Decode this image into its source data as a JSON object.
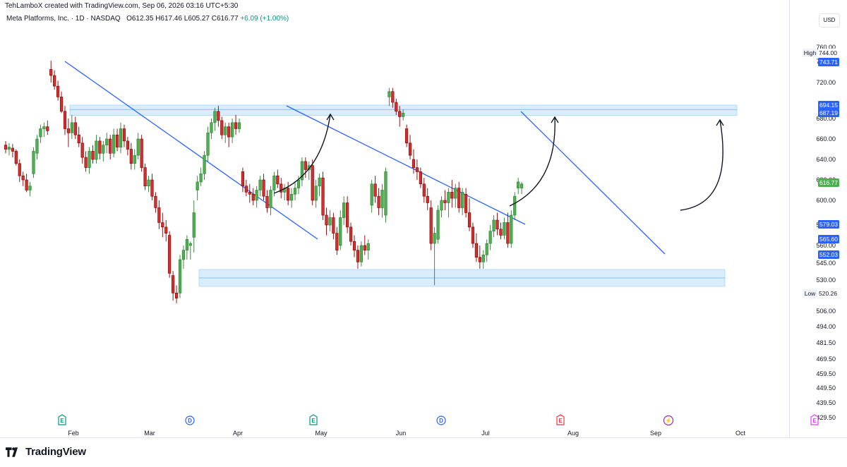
{
  "header": {
    "credit": "TehLamboX created with TradingView.com, Sep 06, 2026 03:16 UTC+5:30",
    "symbol_title": "Meta Platforms, Inc. · 1D · NASDAQ",
    "ohlc": "O612.35  H617.46  L605.27  C616.77",
    "change": "+6.09 (+1.00%)",
    "currency": "USD"
  },
  "footer": {
    "brand": "TradingView"
  },
  "chart_data": {
    "type": "candlestick",
    "symbol": "Meta Platforms, Inc.",
    "interval": "1D",
    "exchange": "NASDAQ",
    "y_axis": {
      "ticks": [
        760.0,
        744.0,
        720.0,
        680.0,
        660.0,
        640.0,
        620.0,
        600.0,
        580.0,
        560.0,
        545.0,
        530.0,
        506.0,
        494.0,
        481.5,
        469.5,
        459.5,
        449.5,
        439.5,
        429.5
      ],
      "range": [
        425,
        770
      ]
    },
    "x_axis": {
      "ticks": [
        "Feb",
        "Mar",
        "Apr",
        "May",
        "Jun",
        "Jul",
        "Aug",
        "Sep",
        "Oct"
      ]
    },
    "price_labels": [
      {
        "value": "744.00",
        "kind": "plain"
      },
      {
        "value": "743.71",
        "kind": "tag"
      },
      {
        "value": "694.15",
        "kind": "tag"
      },
      {
        "value": "687.19",
        "kind": "tag"
      },
      {
        "value": "616.77",
        "kind": "last"
      },
      {
        "value": "579.03",
        "kind": "tag"
      },
      {
        "value": "565.60",
        "kind": "tag"
      },
      {
        "value": "552.03",
        "kind": "tag"
      },
      {
        "value": "520.26",
        "kind": "plain"
      }
    ],
    "high_label": "High",
    "low_label": "Low",
    "zones": [
      {
        "from": 687.19,
        "to": 694.15,
        "color": "#bbdefb"
      },
      {
        "from": 520.26,
        "to": 538.0,
        "color": "#bbdefb"
      }
    ],
    "event_markers": [
      "E",
      "D",
      "E",
      "D",
      "E",
      "⚡",
      "E"
    ],
    "colors": {
      "up": "#089981",
      "up_body": "#4caf50",
      "down": "#b71c1c",
      "down_body": "#d32f2f",
      "trendline": "#2962ff",
      "last": "#4caf50",
      "tag": "#2962ff"
    },
    "candles": [
      [
        654,
        658,
        646,
        650
      ],
      [
        650,
        656,
        644,
        652
      ],
      [
        651,
        655,
        642,
        648
      ],
      [
        648,
        650,
        634,
        636
      ],
      [
        636,
        640,
        618,
        624
      ],
      [
        624,
        628,
        614,
        620
      ],
      [
        620,
        626,
        608,
        610
      ],
      [
        610,
        618,
        604,
        614
      ],
      [
        626,
        652,
        622,
        648
      ],
      [
        646,
        664,
        640,
        660
      ],
      [
        662,
        674,
        656,
        670
      ],
      [
        670,
        676,
        662,
        672
      ],
      [
        672,
        678,
        664,
        668
      ],
      [
        735,
        745,
        720,
        728
      ],
      [
        728,
        734,
        712,
        716
      ],
      [
        716,
        722,
        700,
        704
      ],
      [
        704,
        710,
        686,
        688
      ],
      [
        688,
        694,
        664,
        670
      ],
      [
        670,
        680,
        652,
        666
      ],
      [
        666,
        684,
        660,
        676
      ],
      [
        676,
        682,
        660,
        664
      ],
      [
        664,
        672,
        652,
        656
      ],
      [
        656,
        662,
        636,
        642
      ],
      [
        642,
        648,
        628,
        632
      ],
      [
        632,
        652,
        626,
        648
      ],
      [
        648,
        654,
        636,
        640
      ],
      [
        640,
        664,
        636,
        658
      ],
      [
        658,
        662,
        640,
        646
      ],
      [
        646,
        658,
        638,
        654
      ],
      [
        654,
        666,
        646,
        660
      ],
      [
        660,
        664,
        640,
        646
      ],
      [
        646,
        670,
        642,
        664
      ],
      [
        664,
        670,
        648,
        652
      ],
      [
        652,
        676,
        646,
        670
      ],
      [
        670,
        674,
        652,
        658
      ],
      [
        658,
        662,
        644,
        650
      ],
      [
        650,
        656,
        630,
        636
      ],
      [
        636,
        650,
        630,
        644
      ],
      [
        644,
        666,
        640,
        660
      ],
      [
        660,
        664,
        628,
        632
      ],
      [
        632,
        636,
        610,
        614
      ],
      [
        614,
        624,
        608,
        620
      ],
      [
        620,
        626,
        600,
        604
      ],
      [
        604,
        608,
        590,
        594
      ],
      [
        594,
        600,
        576,
        582
      ],
      [
        582,
        590,
        568,
        578
      ],
      [
        578,
        584,
        564,
        572
      ],
      [
        570,
        574,
        532,
        536
      ],
      [
        534,
        538,
        514,
        520
      ],
      [
        520,
        526,
        512,
        516
      ],
      [
        520,
        552,
        516,
        548
      ],
      [
        548,
        560,
        540,
        556
      ],
      [
        556,
        570,
        548,
        566
      ],
      [
        560,
        564,
        548,
        562
      ],
      [
        568,
        600,
        554,
        590
      ],
      [
        610,
        624,
        600,
        618
      ],
      [
        618,
        632,
        614,
        626
      ],
      [
        626,
        648,
        620,
        644
      ],
      [
        644,
        672,
        638,
        666
      ],
      [
        666,
        680,
        660,
        676
      ],
      [
        676,
        692,
        668,
        688
      ],
      [
        688,
        694,
        672,
        678
      ],
      [
        678,
        682,
        660,
        664
      ],
      [
        664,
        676,
        656,
        672
      ],
      [
        672,
        676,
        652,
        662
      ],
      [
        662,
        680,
        656,
        676
      ],
      [
        676,
        684,
        664,
        670
      ],
      [
        670,
        680,
        666,
        676
      ],
      [
        628,
        632,
        608,
        614
      ],
      [
        614,
        620,
        604,
        608
      ],
      [
        608,
        616,
        598,
        606
      ],
      [
        606,
        612,
        596,
        600
      ],
      [
        600,
        614,
        594,
        610
      ],
      [
        610,
        624,
        604,
        620
      ],
      [
        620,
        626,
        600,
        604
      ],
      [
        604,
        610,
        590,
        594
      ],
      [
        594,
        614,
        588,
        610
      ],
      [
        610,
        628,
        604,
        624
      ],
      [
        624,
        630,
        612,
        616
      ],
      [
        616,
        622,
        602,
        608
      ],
      [
        608,
        616,
        600,
        612
      ],
      [
        612,
        618,
        596,
        600
      ],
      [
        600,
        612,
        594,
        606
      ],
      [
        606,
        618,
        600,
        612
      ],
      [
        612,
        624,
        606,
        620
      ],
      [
        620,
        642,
        614,
        638
      ],
      [
        638,
        642,
        622,
        630
      ],
      [
        630,
        638,
        620,
        634
      ],
      [
        634,
        640,
        596,
        600
      ],
      [
        600,
        620,
        594,
        614
      ],
      [
        614,
        626,
        604,
        622
      ],
      [
        622,
        628,
        584,
        588
      ],
      [
        588,
        594,
        570,
        580
      ],
      [
        580,
        592,
        574,
        586
      ],
      [
        586,
        590,
        566,
        572
      ],
      [
        572,
        578,
        552,
        556
      ],
      [
        560,
        592,
        556,
        586
      ],
      [
        586,
        604,
        580,
        598
      ],
      [
        598,
        604,
        572,
        578
      ],
      [
        578,
        582,
        560,
        564
      ],
      [
        564,
        570,
        550,
        556
      ],
      [
        556,
        560,
        540,
        546
      ],
      [
        546,
        564,
        542,
        560
      ],
      [
        560,
        570,
        552,
        556
      ],
      [
        556,
        566,
        548,
        562
      ],
      [
        596,
        620,
        590,
        616
      ],
      [
        616,
        624,
        598,
        604
      ],
      [
        604,
        612,
        588,
        594
      ],
      [
        594,
        616,
        586,
        610
      ],
      [
        588,
        632,
        582,
        628
      ],
      [
        704,
        714,
        694,
        710
      ],
      [
        710,
        714,
        692,
        698
      ],
      [
        698,
        702,
        684,
        688
      ],
      [
        688,
        694,
        672,
        682
      ],
      [
        682,
        690,
        678,
        686
      ],
      [
        670,
        674,
        652,
        656
      ],
      [
        656,
        664,
        640,
        644
      ],
      [
        640,
        650,
        626,
        632
      ],
      [
        632,
        640,
        620,
        628
      ],
      [
        628,
        632,
        612,
        616
      ],
      [
        616,
        622,
        598,
        604
      ],
      [
        604,
        612,
        592,
        598
      ],
      [
        594,
        600,
        556,
        562
      ],
      [
        562,
        578,
        526,
        572
      ],
      [
        566,
        596,
        562,
        592
      ],
      [
        592,
        604,
        586,
        600
      ],
      [
        600,
        610,
        592,
        598
      ],
      [
        598,
        612,
        586,
        608
      ],
      [
        608,
        620,
        594,
        602
      ],
      [
        602,
        616,
        594,
        612
      ],
      [
        612,
        618,
        590,
        594
      ],
      [
        594,
        612,
        588,
        608
      ],
      [
        606,
        612,
        586,
        590
      ],
      [
        590,
        602,
        574,
        578
      ],
      [
        578,
        582,
        558,
        562
      ],
      [
        562,
        572,
        546,
        550
      ],
      [
        550,
        560,
        540,
        546
      ],
      [
        546,
        556,
        540,
        552
      ],
      [
        552,
        566,
        546,
        562
      ],
      [
        562,
        580,
        556,
        574
      ],
      [
        574,
        588,
        568,
        584
      ],
      [
        584,
        590,
        570,
        576
      ],
      [
        576,
        582,
        566,
        570
      ],
      [
        570,
        586,
        566,
        582
      ],
      [
        582,
        590,
        558,
        562
      ],
      [
        562,
        592,
        558,
        588
      ],
      [
        588,
        608,
        584,
        604
      ],
      [
        612,
        622,
        606,
        618
      ],
      [
        612,
        618,
        606,
        616
      ]
    ]
  }
}
